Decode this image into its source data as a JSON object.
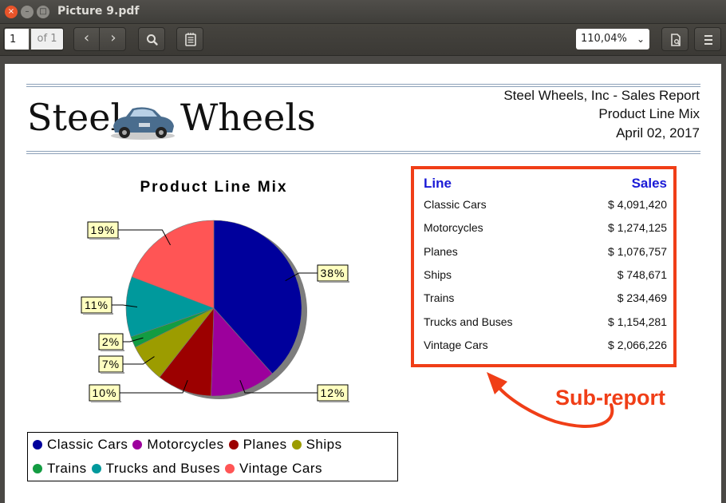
{
  "window": {
    "title": "Picture 9.pdf",
    "close_glyph": "×",
    "min_glyph": "–",
    "max_glyph": "□"
  },
  "toolbar": {
    "page_current": "1",
    "page_of": "of 1",
    "prev_glyph": "‹",
    "next_glyph": "›",
    "zoom": "110,04%",
    "zoom_chevron": "⌄",
    "icons": [
      "search-icon",
      "annotations-icon",
      "document-properties-icon",
      "hamburger-menu-icon"
    ]
  },
  "report": {
    "logo_word_1": "Steel",
    "logo_word_2": "Wheels",
    "header_lines": [
      "Steel Wheels, Inc - Sales Report",
      "Product Line Mix",
      "April 02, 2017"
    ]
  },
  "chart_data": {
    "type": "pie",
    "title": "Product Line Mix",
    "categories": [
      "Classic Cars",
      "Motorcycles",
      "Planes",
      "Ships",
      "Trains",
      "Trucks and Buses",
      "Vintage Cars"
    ],
    "values": [
      38,
      12,
      10,
      7,
      2,
      11,
      19
    ],
    "labels": [
      "38%",
      "12%",
      "10%",
      "7%",
      "2%",
      "11%",
      "19%"
    ],
    "colors": [
      "#00009c",
      "#9c009c",
      "#9c0000",
      "#9c9c00",
      "#139c42",
      "#00999c",
      "#ff5555"
    ],
    "legend_placement": "bottom"
  },
  "subreport": {
    "col_line": "Line",
    "col_sales": "Sales",
    "rows": [
      {
        "line": "Classic Cars",
        "sales": "$ 4,091,420"
      },
      {
        "line": "Motorcycles",
        "sales": "$ 1,274,125"
      },
      {
        "line": "Planes",
        "sales": "$ 1,076,757"
      },
      {
        "line": "Ships",
        "sales": "$ 748,671"
      },
      {
        "line": "Trains",
        "sales": "$ 234,469"
      },
      {
        "line": "Trucks and Buses",
        "sales": "$ 1,154,281"
      },
      {
        "line": "Vintage Cars",
        "sales": "$ 2,066,226"
      }
    ]
  },
  "annotation": {
    "text": "Sub-report",
    "color": "#f03e17"
  }
}
